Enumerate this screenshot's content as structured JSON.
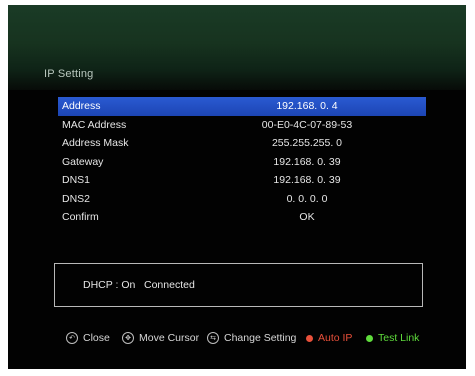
{
  "title": "IP Setting",
  "rows": [
    {
      "label": "Address",
      "value": "192.168. 0. 4"
    },
    {
      "label": "MAC Address",
      "value": "00-E0-4C-07-89-53"
    },
    {
      "label": "Address Mask",
      "value": "255.255.255. 0"
    },
    {
      "label": "Gateway",
      "value": "192.168. 0. 39"
    },
    {
      "label": "DNS1",
      "value": "192.168. 0. 39"
    },
    {
      "label": "DNS2",
      "value": "0. 0. 0. 0"
    },
    {
      "label": "Confirm",
      "value": "OK"
    }
  ],
  "status": {
    "dhcp": "DHCP : On",
    "connection": "Connected"
  },
  "footer": {
    "close": "Close",
    "move_cursor": "Move Cursor",
    "change_setting": "Change Setting",
    "auto_ip": "Auto IP",
    "test_link": "Test Link"
  },
  "colors": {
    "selection": "#2553c8",
    "auto_ip": "#e8503a",
    "test_link": "#5fdc3c"
  }
}
